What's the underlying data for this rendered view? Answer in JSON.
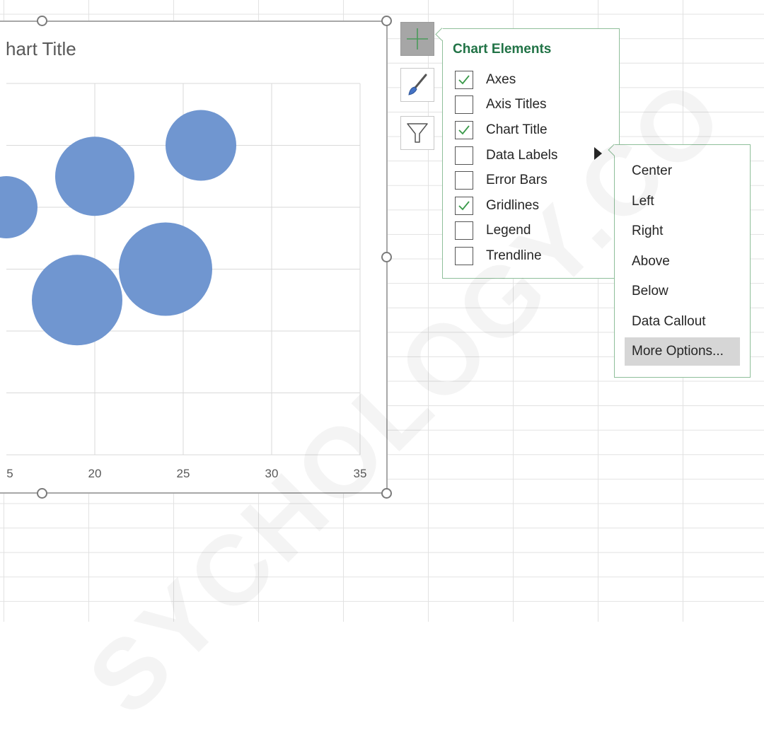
{
  "chart": {
    "title": "hart Title",
    "x_ticks": [
      "5",
      "20",
      "25",
      "30",
      "35"
    ]
  },
  "chart_data": {
    "type": "scatter",
    "title": "Chart Title",
    "x": [
      15,
      19,
      20,
      24,
      26
    ],
    "y": [
      4,
      2.5,
      4.5,
      3,
      5
    ],
    "size": [
      44,
      64,
      56,
      66,
      50
    ],
    "xlim": [
      15,
      35
    ],
    "ylim": [
      0,
      6
    ],
    "grid": true,
    "color": "#7096d0"
  },
  "toolbar": {
    "buttons": [
      {
        "icon": "plus-icon",
        "active": true
      },
      {
        "icon": "brush-icon",
        "active": false
      },
      {
        "icon": "filter-icon",
        "active": false
      }
    ]
  },
  "chart_elements": {
    "title": "Chart Elements",
    "items": [
      {
        "label": "Axes",
        "checked": true
      },
      {
        "label": "Axis Titles",
        "checked": false
      },
      {
        "label": "Chart Title",
        "checked": true
      },
      {
        "label": "Data Labels",
        "checked": false
      },
      {
        "label": "Error Bars",
        "checked": false
      },
      {
        "label": "Gridlines",
        "checked": true
      },
      {
        "label": "Legend",
        "checked": false
      },
      {
        "label": "Trendline",
        "checked": false
      }
    ]
  },
  "data_labels_menu": {
    "items": [
      "Center",
      "Left",
      "Right",
      "Above",
      "Below",
      "Data Callout",
      "More Options..."
    ],
    "highlighted": "More Options..."
  },
  "watermark": "SYCHOLOGY.CO",
  "colors": {
    "accent": "#217346",
    "bubble": "#7096d0"
  }
}
